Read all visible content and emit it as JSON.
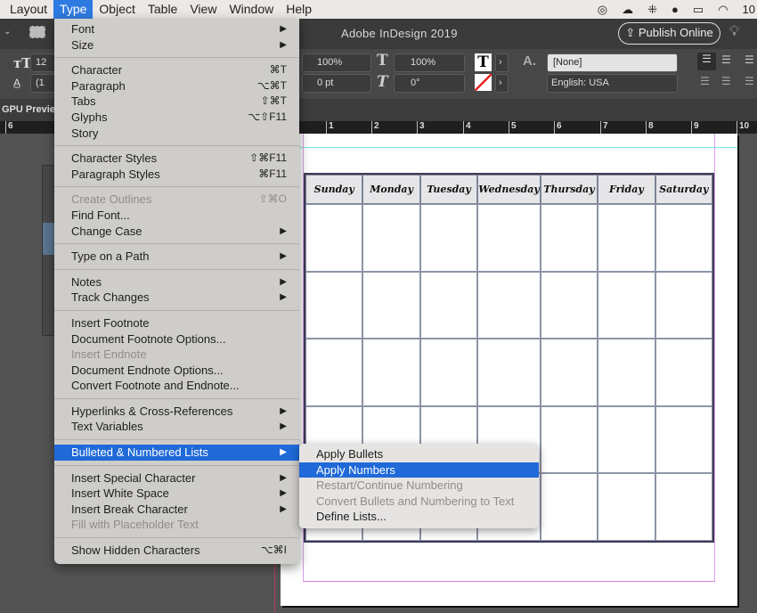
{
  "menubar": {
    "items": [
      "Layout",
      "Type",
      "Object",
      "Table",
      "View",
      "Window",
      "Help"
    ],
    "active": "Type",
    "clock": "10"
  },
  "app": {
    "title": "Adobe InDesign 2019",
    "publish_label": "Publish Online",
    "gpu_label": "GPU Preview"
  },
  "control": {
    "scale_h": "100%",
    "baseline": "0 pt",
    "scale_v": "100%",
    "skew": "0°",
    "char_style": "[None]",
    "language": "English: USA",
    "size_partial": "12",
    "leading_partial": "(1"
  },
  "ruler": {
    "ticks": [
      "6",
      "1",
      "2",
      "3",
      "4",
      "5",
      "6",
      "7",
      "8",
      "9",
      "10"
    ]
  },
  "type_menu": {
    "items": [
      {
        "label": "Font",
        "shortcut": "",
        "submenu": true
      },
      {
        "label": "Size",
        "shortcut": "",
        "submenu": true
      },
      {
        "sep": true
      },
      {
        "label": "Character",
        "shortcut": "⌘T"
      },
      {
        "label": "Paragraph",
        "shortcut": "⌥⌘T"
      },
      {
        "label": "Tabs",
        "shortcut": "⇧⌘T"
      },
      {
        "label": "Glyphs",
        "shortcut": "⌥⇧F11"
      },
      {
        "label": "Story",
        "shortcut": ""
      },
      {
        "sep": true
      },
      {
        "label": "Character Styles",
        "shortcut": "⇧⌘F11"
      },
      {
        "label": "Paragraph Styles",
        "shortcut": "⌘F11"
      },
      {
        "sep": true
      },
      {
        "label": "Create Outlines",
        "shortcut": "⇧⌘O",
        "disabled": true
      },
      {
        "label": "Find Font...",
        "shortcut": ""
      },
      {
        "label": "Change Case",
        "shortcut": "",
        "submenu": true
      },
      {
        "sep": true
      },
      {
        "label": "Type on a Path",
        "shortcut": "",
        "submenu": true
      },
      {
        "sep": true
      },
      {
        "label": "Notes",
        "shortcut": "",
        "submenu": true
      },
      {
        "label": "Track Changes",
        "shortcut": "",
        "submenu": true
      },
      {
        "sep": true
      },
      {
        "label": "Insert Footnote",
        "shortcut": ""
      },
      {
        "label": "Document Footnote Options...",
        "shortcut": ""
      },
      {
        "label": "Insert Endnote",
        "shortcut": "",
        "disabled": true
      },
      {
        "label": "Document Endnote Options...",
        "shortcut": ""
      },
      {
        "label": "Convert Footnote and Endnote...",
        "shortcut": ""
      },
      {
        "sep": true
      },
      {
        "label": "Hyperlinks & Cross-References",
        "shortcut": "",
        "submenu": true
      },
      {
        "label": "Text Variables",
        "shortcut": "",
        "submenu": true
      },
      {
        "sep": true
      },
      {
        "label": "Bulleted & Numbered Lists",
        "shortcut": "",
        "submenu": true,
        "highlighted": true
      },
      {
        "sep": true
      },
      {
        "label": "Insert Special Character",
        "shortcut": "",
        "submenu": true
      },
      {
        "label": "Insert White Space",
        "shortcut": "",
        "submenu": true
      },
      {
        "label": "Insert Break Character",
        "shortcut": "",
        "submenu": true
      },
      {
        "label": "Fill with Placeholder Text",
        "shortcut": "",
        "disabled": true
      },
      {
        "sep": true
      },
      {
        "label": "Show Hidden Characters",
        "shortcut": "⌥⌘I"
      }
    ]
  },
  "lists_submenu": {
    "items": [
      {
        "label": "Apply Bullets"
      },
      {
        "label": "Apply Numbers",
        "highlighted": true
      },
      {
        "label": "Restart/Continue Numbering",
        "disabled": true
      },
      {
        "label": "Convert Bullets and Numbering to Text",
        "disabled": true
      },
      {
        "label": "Define Lists..."
      }
    ]
  },
  "calendar": {
    "days": [
      "Sunday",
      "Monday",
      "Tuesday",
      "Wednesday",
      "Thursday",
      "Friday",
      "Saturday"
    ]
  },
  "colors": {
    "highlight": "#1f69d8",
    "pasteboard": "#535353"
  }
}
